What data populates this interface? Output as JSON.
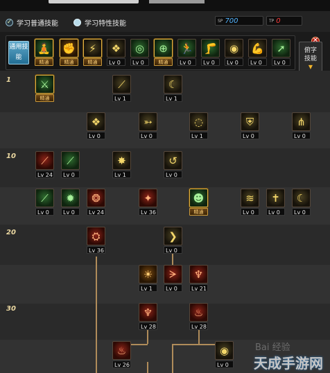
{
  "header": {
    "radio_normal": "学习普通技能",
    "radio_special": "学习特性技能",
    "sp_tag": "SP",
    "sp_value": "700",
    "tp_tag": "TP",
    "tp_value": "0"
  },
  "common_label": "通用技能",
  "side_label": "俯字技能",
  "levels": {
    "l1": "1",
    "l10": "10",
    "l20": "20",
    "l30": "30"
  },
  "top_skills": [
    {
      "icon": "meditate-icon",
      "label": "精通"
    },
    {
      "icon": "strike-icon",
      "label": "精通"
    },
    {
      "icon": "rush-icon",
      "label": "精通"
    },
    {
      "icon": "wing-icon",
      "label": "Lv 0"
    },
    {
      "icon": "target-icon",
      "label": "Lv 0"
    },
    {
      "icon": "crosshair-icon",
      "label": "精通"
    },
    {
      "icon": "runner-icon",
      "label": "Lv 0"
    },
    {
      "icon": "kick-icon",
      "label": "Lv 0"
    },
    {
      "icon": "orb-icon",
      "label": "Lv 0"
    },
    {
      "icon": "muscle-icon",
      "label": "Lv 0"
    },
    {
      "icon": "sprint-icon",
      "label": "Lv 0"
    }
  ],
  "tree": [
    {
      "name": "sword-slash-icon",
      "label": "精通"
    },
    {
      "name": "claw-icon",
      "label": "Lv 1"
    },
    {
      "name": "crescent-icon",
      "label": "Lv 1"
    },
    {
      "name": "wing-burst-icon",
      "label": "Lv 0"
    },
    {
      "name": "arrow-dash-icon",
      "label": "Lv 0"
    },
    {
      "name": "spiral-icon",
      "label": "Lv 1"
    },
    {
      "name": "shield-icon",
      "label": "Lv 0"
    },
    {
      "name": "fan-icon",
      "label": "Lv 0"
    },
    {
      "name": "flame-blade-icon",
      "label": "Lv 24"
    },
    {
      "name": "green-blade-icon",
      "label": "Lv 0"
    },
    {
      "name": "fire-burst-icon",
      "label": "Lv 1"
    },
    {
      "name": "swirl-icon",
      "label": "Lv 0"
    },
    {
      "name": "dagger-icon",
      "label": "Lv 0"
    },
    {
      "name": "starburst-icon",
      "label": "Lv 0"
    },
    {
      "name": "triple-orb-icon",
      "label": "Lv 24"
    },
    {
      "name": "fire-crack-icon",
      "label": "Lv 36"
    },
    {
      "name": "plus-head-icon",
      "label": "精通"
    },
    {
      "name": "wave-icon",
      "label": "Lv 0"
    },
    {
      "name": "cross-light-icon",
      "label": "Lv 0"
    },
    {
      "name": "moon-slash-icon",
      "label": "Lv 0"
    },
    {
      "name": "fire-mark-icon",
      "label": "Lv 36"
    },
    {
      "name": "boomerang-icon",
      "label": "Lv 0"
    },
    {
      "name": "sun-face-icon",
      "label": "Lv 1"
    },
    {
      "name": "red-bow-icon",
      "label": "Lv 0"
    },
    {
      "name": "warrior-icon",
      "label": "Lv 21"
    },
    {
      "name": "red-figure-icon",
      "label": "Lv 28"
    },
    {
      "name": "flame-figure-icon",
      "label": "Lv 28"
    },
    {
      "name": "phoenix-icon",
      "label": "Lv 26"
    },
    {
      "name": "eye-icon",
      "label": "Lv 0"
    }
  ],
  "watermark_top": "Bai 经验",
  "watermark_bottom": "天成手游网"
}
